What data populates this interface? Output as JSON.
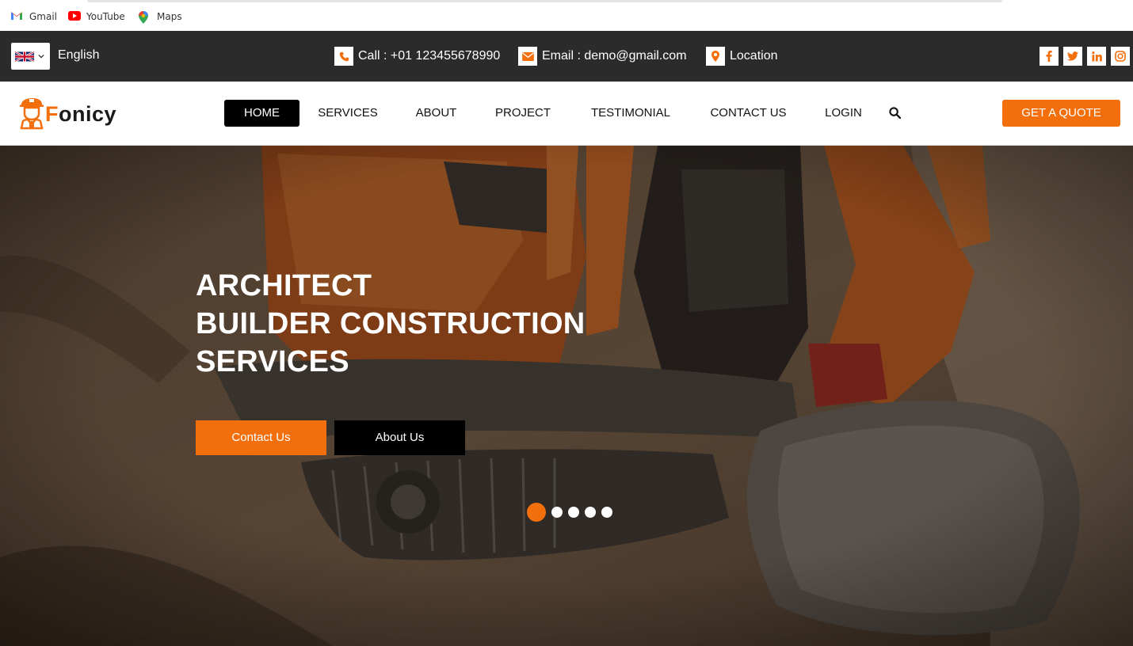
{
  "bookmarks": [
    {
      "label": "Gmail",
      "icon": "gmail-icon"
    },
    {
      "label": "YouTube",
      "icon": "youtube-icon"
    },
    {
      "label": "Maps",
      "icon": "maps-icon"
    }
  ],
  "topbar": {
    "language": "English",
    "phone": "Call : +01 123455678990",
    "email": "Email : demo@gmail.com",
    "location": "Location",
    "socials": [
      "facebook-icon",
      "twitter-icon",
      "linkedin-icon",
      "instagram-icon"
    ]
  },
  "brand": {
    "logo_text_accent": "F",
    "logo_text_rest": "onicy"
  },
  "nav": {
    "items": [
      "HOME",
      "SERVICES",
      "ABOUT",
      "PROJECT",
      "TESTIMONIAL",
      "CONTACT US",
      "LOGIN"
    ],
    "active": "HOME",
    "cta": "GET A QUOTE"
  },
  "hero": {
    "title_lines": [
      "ARCHITECT",
      "BUILDER CONSTRUCTION",
      "SERVICES"
    ],
    "primary_button": "Contact Us",
    "secondary_button": "About Us",
    "slides_total": 5,
    "slide_active": 1
  },
  "colors": {
    "accent": "#f26f0c",
    "dark_bar": "#2b2b2b",
    "black": "#000000"
  }
}
